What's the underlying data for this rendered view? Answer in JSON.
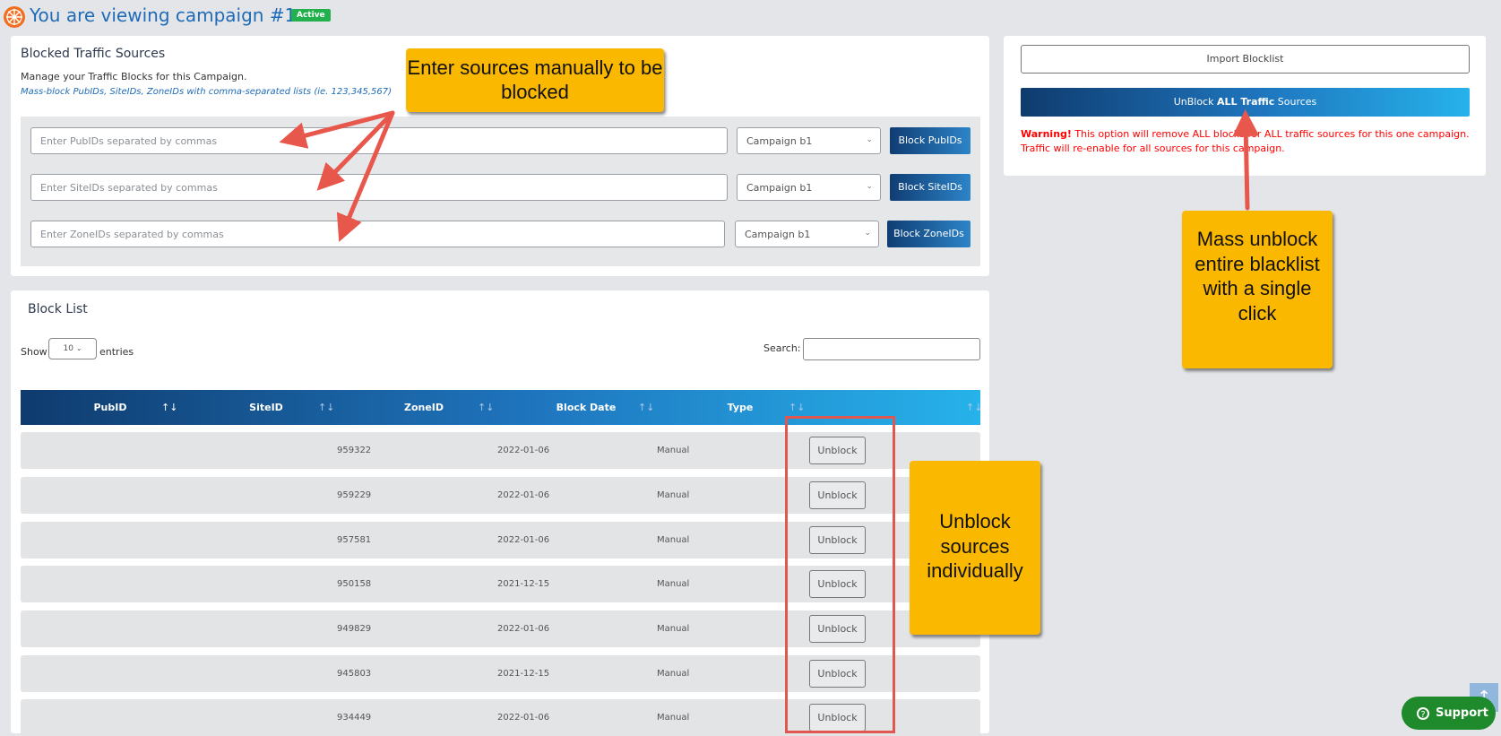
{
  "header": {
    "title": "You are viewing campaign #1",
    "status_badge": "Active"
  },
  "blocked_sources": {
    "title": "Blocked Traffic Sources",
    "description": "Manage your Traffic Blocks for this Campaign.",
    "hint": "Mass-block PubIDs, SiteIDs, ZoneIDs with comma-separated lists (ie. 123,345,567)",
    "rows": [
      {
        "placeholder": "Enter PubIDs separated by commas",
        "campaign": "Campaign b1",
        "button": "Block PubIDs"
      },
      {
        "placeholder": "Enter SiteIDs separated by commas",
        "campaign": "Campaign b1",
        "button": "Block SiteIDs"
      },
      {
        "placeholder": "Enter ZoneIDs separated by commas",
        "campaign": "Campaign b1",
        "button": "Block ZoneIDs"
      }
    ]
  },
  "actions": {
    "import_label": "Import Blocklist",
    "unblock_all_prefix": "UnBlock ",
    "unblock_all_bold": "ALL Traffic",
    "unblock_all_suffix": " Sources",
    "warning_label": "Warning!",
    "warning_text": " This option will remove ALL blocks for ALL traffic sources for this one campaign.",
    "warning_text2": "Traffic will re-enable for all sources for this campaign."
  },
  "block_list": {
    "title": "Block List",
    "show_label": "Show",
    "entries_value": "10",
    "entries_label": "entries",
    "search_label": "Search:",
    "columns": [
      "PubID",
      "SiteID",
      "ZoneID",
      "Block Date",
      "Type"
    ],
    "rows": [
      {
        "pubid": "",
        "siteid": "",
        "zoneid": "959322",
        "date": "2022-01-06",
        "type": "Manual",
        "action": "Unblock"
      },
      {
        "pubid": "",
        "siteid": "",
        "zoneid": "959229",
        "date": "2022-01-06",
        "type": "Manual",
        "action": "Unblock"
      },
      {
        "pubid": "",
        "siteid": "",
        "zoneid": "957581",
        "date": "2022-01-06",
        "type": "Manual",
        "action": "Unblock"
      },
      {
        "pubid": "",
        "siteid": "",
        "zoneid": "950158",
        "date": "2021-12-15",
        "type": "Manual",
        "action": "Unblock"
      },
      {
        "pubid": "",
        "siteid": "",
        "zoneid": "949829",
        "date": "2022-01-06",
        "type": "Manual",
        "action": "Unblock"
      },
      {
        "pubid": "",
        "siteid": "",
        "zoneid": "945803",
        "date": "2021-12-15",
        "type": "Manual",
        "action": "Unblock"
      },
      {
        "pubid": "",
        "siteid": "",
        "zoneid": "934449",
        "date": "2022-01-06",
        "type": "Manual",
        "action": "Unblock"
      }
    ]
  },
  "annotations": {
    "manual": "Enter sources manually to be blocked",
    "mass": "Mass unblock entire blacklist with a single click",
    "individual": "Unblock sources individually"
  },
  "support": {
    "label": "Support"
  },
  "colors": {
    "accent": "#1e6bb8",
    "annotation": "#fbb800",
    "arrow": "#e8574c",
    "warning": "#ff0000"
  }
}
